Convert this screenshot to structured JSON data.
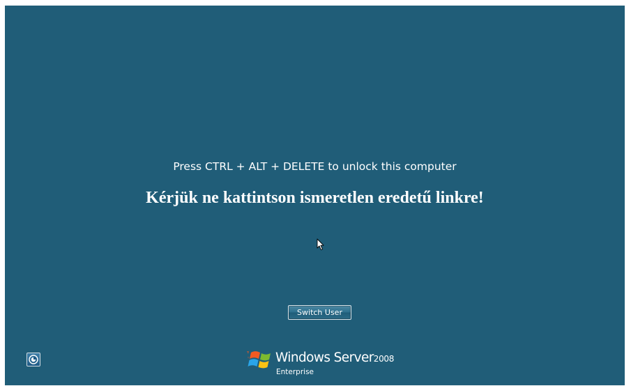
{
  "lock_screen": {
    "prompt": "Press CTRL + ALT + DELETE to unlock this computer",
    "notice": "Kérjük ne kattintson ismeretlen eredetű linkre!",
    "switch_user_label": "Switch User",
    "background_color": "#205d78"
  },
  "branding": {
    "product_name": "Windows Server",
    "version": "2008",
    "edition": "Enterprise"
  },
  "icons": {
    "ease_of_access": "ease-of-access-icon",
    "logo": "windows-flag-icon",
    "cursor": "mouse-pointer-icon"
  }
}
